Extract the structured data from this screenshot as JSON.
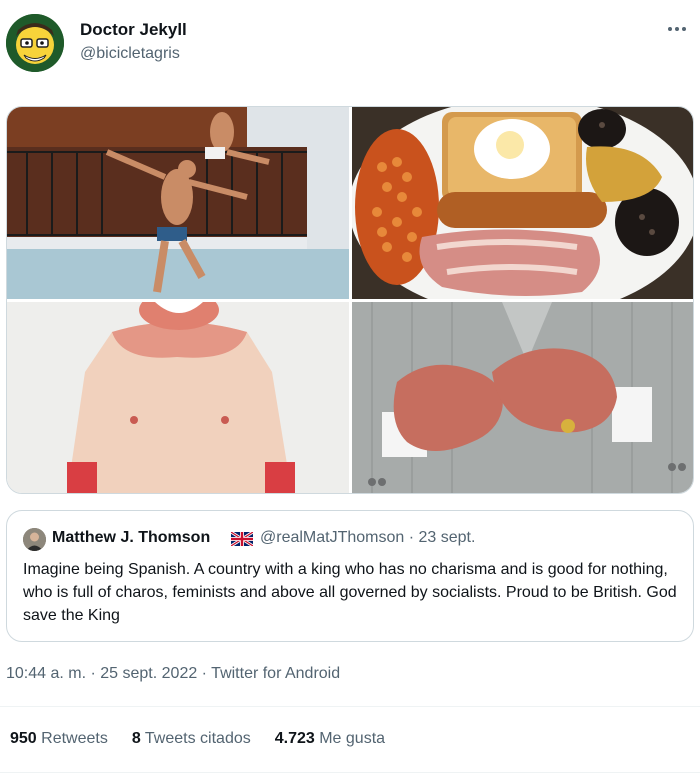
{
  "author": {
    "display_name": "Doctor Jekyll",
    "handle": "@bicicletagris",
    "avatar_icon": "cartoon-avatar-icon"
  },
  "quoted_tweet": {
    "display_name": "Matthew J. Thomson",
    "flag_icon": "uk-flag-icon",
    "handle_date": "@realMatJThomson · 23 sept.",
    "text": "Imagine being Spanish. A country with a king who has no charisma and is good for nothing, who is full of charos, feminists and above all governed by socialists. Proud to be British. God save the King"
  },
  "meta": {
    "time": "10:44 a. m.",
    "separator1": " · ",
    "date": "25 sept. 2022",
    "separator2": " · ",
    "source": "Twitter for Android"
  },
  "stats": {
    "retweets_count": "950",
    "retweets_label": " Retweets",
    "quotes_count": "8",
    "quotes_label": " Tweets citados",
    "likes_count": "4.723",
    "likes_label": " Me gusta"
  },
  "colors": {
    "text": "#0f1419",
    "secondary": "#536471",
    "border": "#cfd9de"
  }
}
